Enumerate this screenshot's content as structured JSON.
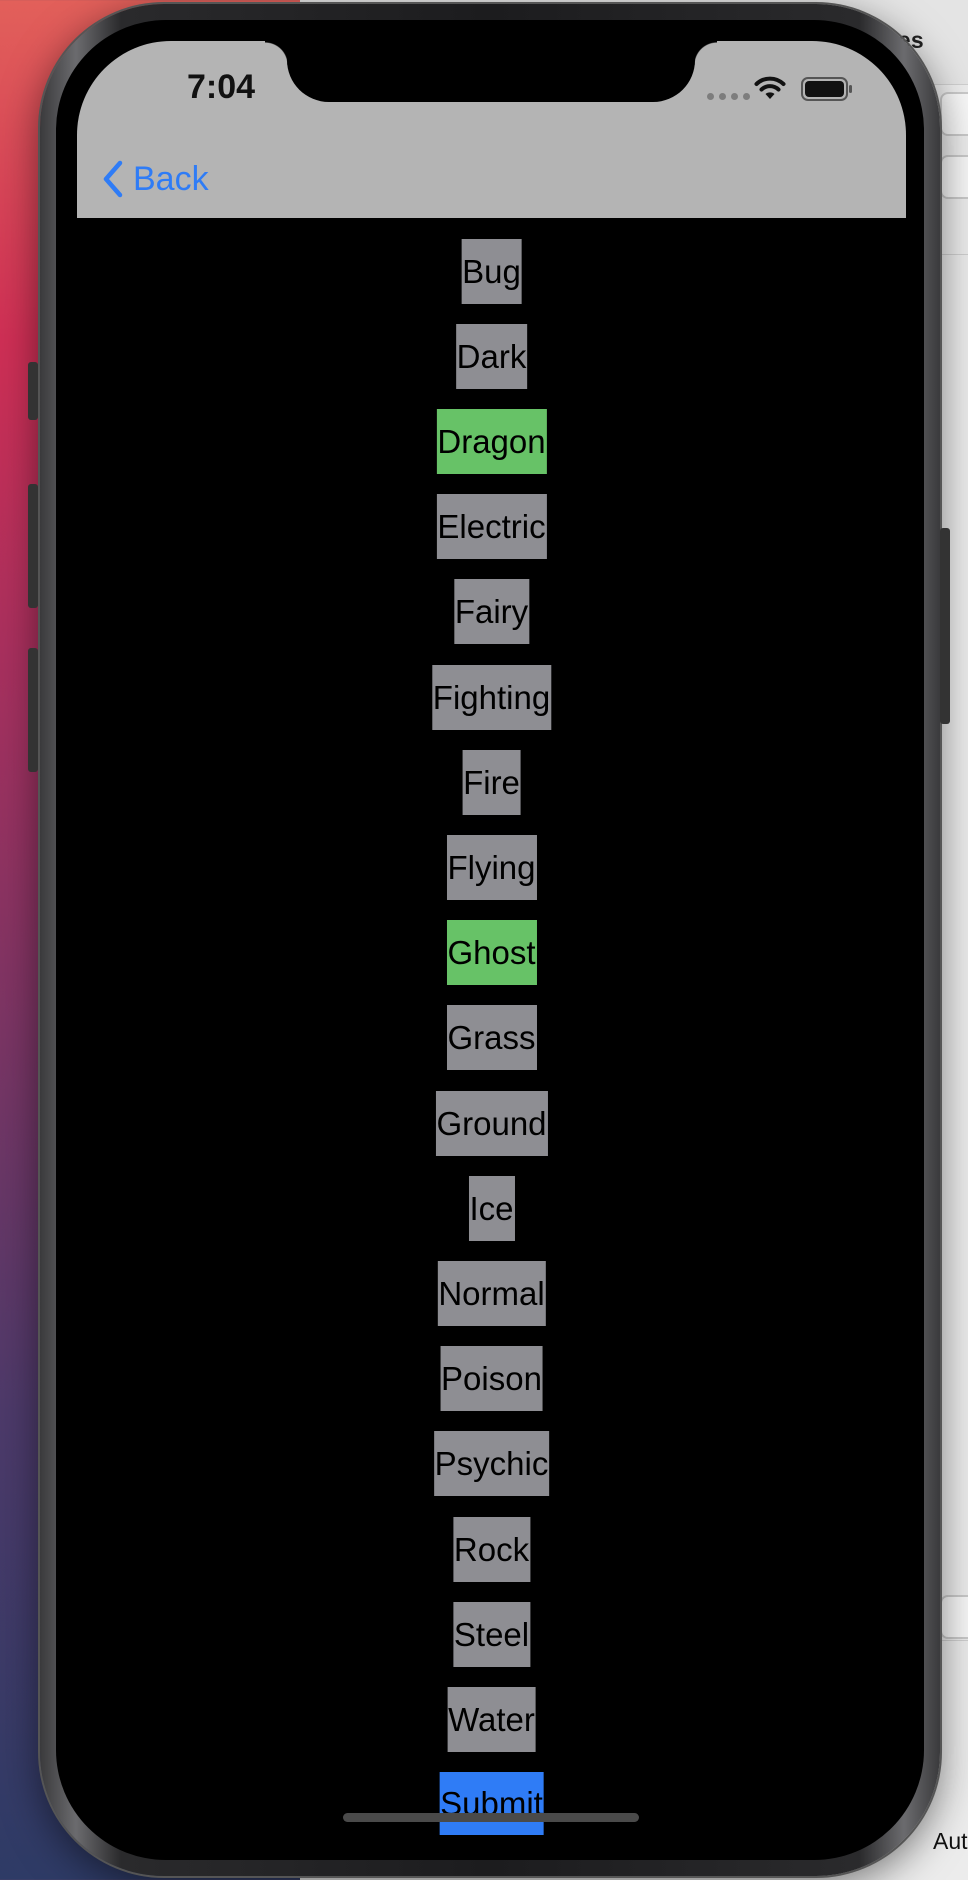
{
  "background_window": {
    "title_fragment": "ices",
    "bottom_fragment": "Aut"
  },
  "status_bar": {
    "time": "7:04",
    "icons": [
      "signal-icon",
      "wifi-icon",
      "battery-icon"
    ]
  },
  "nav": {
    "back_label": "Back",
    "back_icon": "chevron-left-icon",
    "accent_color": "#2f7cf6"
  },
  "types": [
    {
      "label": "Bug",
      "selected": false
    },
    {
      "label": "Dark",
      "selected": false
    },
    {
      "label": "Dragon",
      "selected": true
    },
    {
      "label": "Electric",
      "selected": false
    },
    {
      "label": "Fairy",
      "selected": false
    },
    {
      "label": "Fighting",
      "selected": false
    },
    {
      "label": "Fire",
      "selected": false
    },
    {
      "label": "Flying",
      "selected": false
    },
    {
      "label": "Ghost",
      "selected": true
    },
    {
      "label": "Grass",
      "selected": false
    },
    {
      "label": "Ground",
      "selected": false
    },
    {
      "label": "Ice",
      "selected": false
    },
    {
      "label": "Normal",
      "selected": false
    },
    {
      "label": "Poison",
      "selected": false
    },
    {
      "label": "Psychic",
      "selected": false
    },
    {
      "label": "Rock",
      "selected": false
    },
    {
      "label": "Steel",
      "selected": false
    },
    {
      "label": "Water",
      "selected": false
    }
  ],
  "colors": {
    "unselected": "#8e8e93",
    "selected": "#67c267",
    "submit": "#2f7cf6"
  },
  "submit_label": "Submit"
}
